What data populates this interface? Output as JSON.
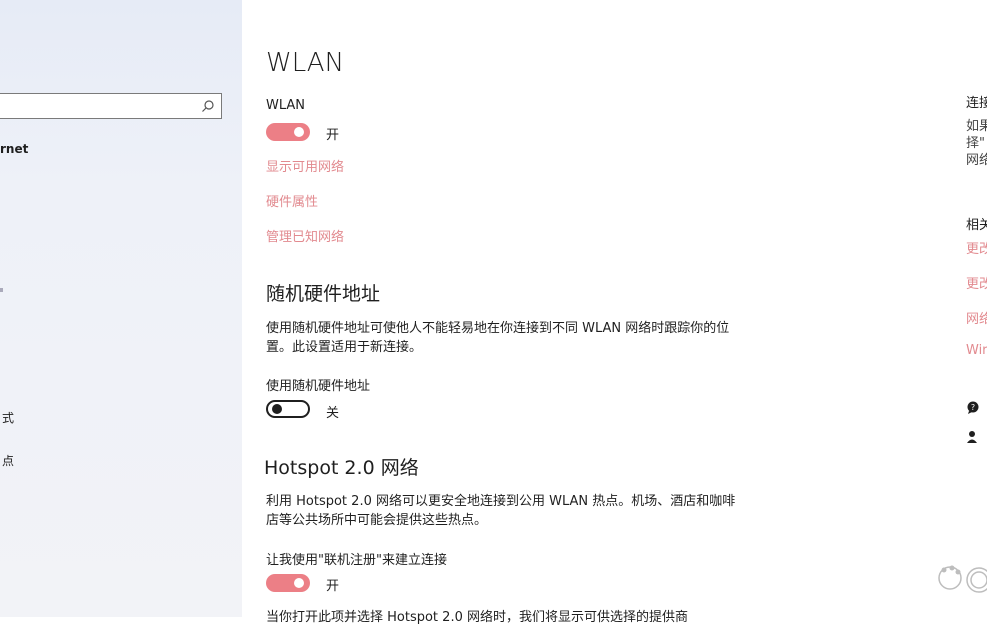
{
  "sidebar": {
    "search": {
      "placeholder": ""
    },
    "items": [
      {
        "label": "rnet"
      },
      {
        "label": "式"
      },
      {
        "label": "点"
      }
    ]
  },
  "main": {
    "page_title": "WLAN",
    "wlan": {
      "label": "WLAN",
      "toggle_state": "开",
      "toggle_on": true
    },
    "links": [
      "显示可用网络",
      "硬件属性",
      "管理已知网络"
    ],
    "random_hw": {
      "heading": "随机硬件地址",
      "description": "使用随机硬件地址可使他人不能轻易地在你连接到不同 WLAN 网络时跟踪你的位置。此设置适用于新连接。",
      "toggle_label": "使用随机硬件地址",
      "toggle_state": "关",
      "toggle_on": false
    },
    "hotspot": {
      "heading": "Hotspot 2.0 网络",
      "description": "利用 Hotspot 2.0 网络可以更安全地连接到公用 WLAN 热点。机场、酒店和咖啡店等公共场所中可能会提供这些热点。",
      "toggle_label": "让我使用\"联机注册\"来建立连接",
      "toggle_state": "开",
      "toggle_on": true,
      "footer_text": "当你打开此项并选择 Hotspot 2.0 网络时，我们将显示可供选择的提供商"
    }
  },
  "right_panel": {
    "title": "连接",
    "desc_lines": [
      "如果",
      "择\"",
      "网络"
    ],
    "related": "相关",
    "links": [
      "更改",
      "更改",
      "网络",
      "Wir"
    ],
    "help_icon": "chat-help-icon",
    "feedback_icon": "feedback-person-icon"
  },
  "colors": {
    "accent": "#ec7f86",
    "link": "#e28a8f",
    "sidebar_bg": "#eef1f8"
  }
}
